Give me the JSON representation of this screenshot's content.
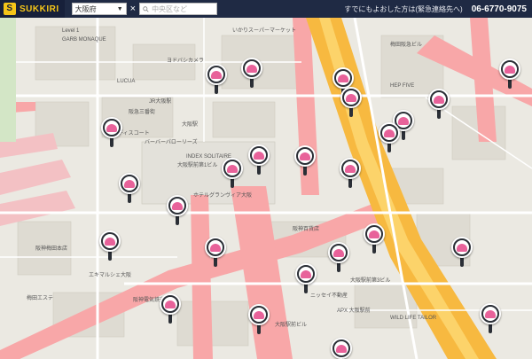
{
  "header": {
    "logo_text": "SUKKIRI",
    "logo_mark": "S",
    "prefecture": "大阪府",
    "clear_symbol": "×",
    "search_placeholder": "中央区など",
    "note": "すでにもよおした方は(緊急連絡先へ)",
    "phone": "06-6770-9075"
  },
  "colors": {
    "header_bg": "#1f2a44",
    "logo_yellow": "#f5c518",
    "major_road": "#f8a7a8",
    "highway": "#f7b940",
    "marker_pink": "#e8629a",
    "marker_dark": "#2b2f36"
  },
  "map": {
    "labels": [
      "Level 1",
      "GARB MONAQUE",
      "いかりスーパーマーケット",
      "LUCUA",
      "JR大阪駅",
      "大阪駅",
      "ディスコート",
      "バーバーパローリーズ",
      "ヨドバシカメラ",
      "INDEX SOLITAIRE",
      "大阪駅前第1ビル",
      "ホテルグランヴィア大阪",
      "阪神百貨店",
      "梅田阪急ビル",
      "HEP FIVE",
      "大阪駅前第3ビル",
      "阪神電気鉄道",
      "ニッセイ不動産",
      "阪急三番街",
      "APX 大阪駅前",
      "WILD LIFE TAILOR",
      "大阪駅前ビル",
      "梅田エステ",
      "エキマルシェ大阪",
      "阪神梅田本店"
    ],
    "markers_count_note": "",
    "markers": [
      {
        "id": "m1"
      },
      {
        "id": "m2"
      },
      {
        "id": "m3"
      },
      {
        "id": "m4"
      },
      {
        "id": "m5"
      },
      {
        "id": "m6"
      },
      {
        "id": "m7"
      },
      {
        "id": "m8"
      },
      {
        "id": "m9"
      },
      {
        "id": "m10"
      },
      {
        "id": "m11"
      },
      {
        "id": "m12"
      },
      {
        "id": "m13"
      },
      {
        "id": "m14"
      },
      {
        "id": "m15"
      },
      {
        "id": "m16"
      },
      {
        "id": "m17"
      },
      {
        "id": "m18"
      },
      {
        "id": "m19"
      },
      {
        "id": "m20"
      },
      {
        "id": "m21"
      },
      {
        "id": "m22"
      },
      {
        "id": "m23"
      },
      {
        "id": "m24"
      },
      {
        "id": "m25"
      },
      {
        "id": "m26"
      },
      {
        "id": "m27"
      }
    ]
  }
}
